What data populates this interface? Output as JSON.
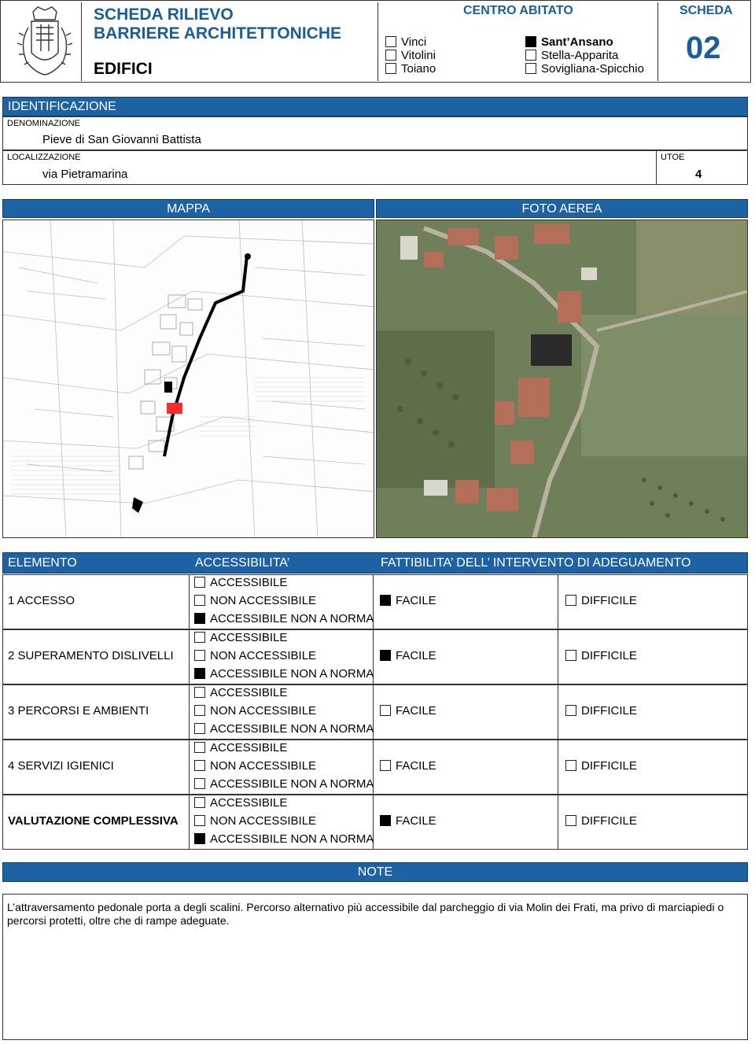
{
  "header": {
    "title_line1": "SCHEDA RILIEVO",
    "title_line2": "BARRIERE ARCHITETTONICHE",
    "subtitle": "EDIFICI",
    "centro_title": "CENTRO ABITATO",
    "centri": [
      {
        "label": "Vinci",
        "checked": false
      },
      {
        "label": "Vitolini",
        "checked": false
      },
      {
        "label": "Toiano",
        "checked": false
      },
      {
        "label": "Sant’Ansano",
        "checked": true
      },
      {
        "label": "Stella-Apparita",
        "checked": false
      },
      {
        "label": "Sovigliana-Spicchio",
        "checked": false
      }
    ],
    "scheda_label": "SCHEDA",
    "scheda_number": "02"
  },
  "identificazione": {
    "section_title": "IDENTIFICAZIONE",
    "denominazione_label": "DENOMINAZIONE",
    "denominazione_value": "Pieve di San Giovanni Battista",
    "localizzazione_label": "LOCALIZZAZIONE",
    "localizzazione_value": "via Pietramarina",
    "utoe_label": "UTOE",
    "utoe_value": "4"
  },
  "images": {
    "mappa_label": "MAPPA",
    "foto_label": "FOTO AEREA"
  },
  "valutazione": {
    "col_elemento": "ELEMENTO",
    "col_accessibilita": "ACCESSIBILITA’",
    "col_fattibilita": "FATTIBILITA’ DELL’ INTERVENTO DI ADEGUAMENTO",
    "opt_accessibile": "ACCESSIBILE",
    "opt_non_accessibile": "NON ACCESSIBILE",
    "opt_non_a_norma": "ACCESSIBILE NON A NORMA",
    "opt_facile": "FACILE",
    "opt_difficile": "DIFFICILE",
    "rows": [
      {
        "label": "1 ACCESSO",
        "accessibile": false,
        "non_accessibile": false,
        "non_a_norma": true,
        "facile": true,
        "difficile": false
      },
      {
        "label": "2 SUPERAMENTO DISLIVELLI",
        "accessibile": false,
        "non_accessibile": false,
        "non_a_norma": true,
        "facile": true,
        "difficile": false
      },
      {
        "label": "3 PERCORSI E AMBIENTI",
        "accessibile": false,
        "non_accessibile": false,
        "non_a_norma": false,
        "facile": false,
        "difficile": false
      },
      {
        "label": "4 SERVIZI IGIENICI",
        "accessibile": false,
        "non_accessibile": false,
        "non_a_norma": false,
        "facile": false,
        "difficile": false
      },
      {
        "label": "VALUTAZIONE COMPLESSIVA",
        "accessibile": false,
        "non_accessibile": false,
        "non_a_norma": true,
        "facile": true,
        "difficile": false
      }
    ]
  },
  "note": {
    "title": "NOTE",
    "text": "L’attraversamento pedonale porta a degli scalini. Percorso alternativo più accessibile dal parcheggio di via Molin dei Frati, ma privo di marciapiedi o percorsi protetti, oltre che di rampe adeguate."
  }
}
